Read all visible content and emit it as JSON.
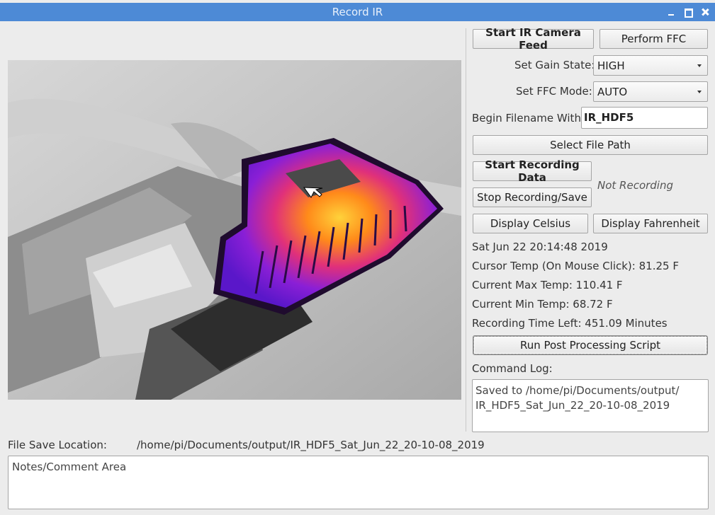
{
  "window": {
    "title": "Record IR"
  },
  "controls": {
    "start_camera": "Start IR Camera Feed",
    "perform_ffc": "Perform FFC",
    "gain_label": "Set Gain State:",
    "gain_value": "HIGH",
    "ffc_label": "Set FFC Mode:",
    "ffc_value": "AUTO",
    "filename_label": "Begin Filename With:",
    "filename_value": "IR_HDF5",
    "select_path": "Select File Path",
    "start_recording": "Start Recording Data",
    "stop_recording": "Stop Recording/Save",
    "recording_status": "Not Recording",
    "display_celsius": "Display Celsius",
    "display_fahrenheit": "Display Fahrenheit"
  },
  "status": {
    "datetime": "Sat Jun 22 20:14:48 2019",
    "cursor_temp": "Cursor Temp (On Mouse Click): 81.25 F",
    "max_temp": "Current Max Temp: 110.41 F",
    "min_temp": "Current Min Temp: 68.72 F",
    "time_left": "Recording Time Left: 451.09 Minutes"
  },
  "post_processing": {
    "run_script": "Run Post Processing Script"
  },
  "log": {
    "label": "Command Log:",
    "line1": "Saved to /home/pi/Documents/output/",
    "line2": "IR_HDF5_Sat_Jun_22_20-10-08_2019"
  },
  "footer": {
    "save_location_label": "File Save Location:",
    "save_location_value": "/home/pi/Documents/output/IR_HDF5_Sat_Jun_22_20-10-08_2019",
    "notes_text": "Notes/Comment Area"
  },
  "colors": {
    "titlebar": "#4d8ad6",
    "window_bg": "#ececec"
  }
}
